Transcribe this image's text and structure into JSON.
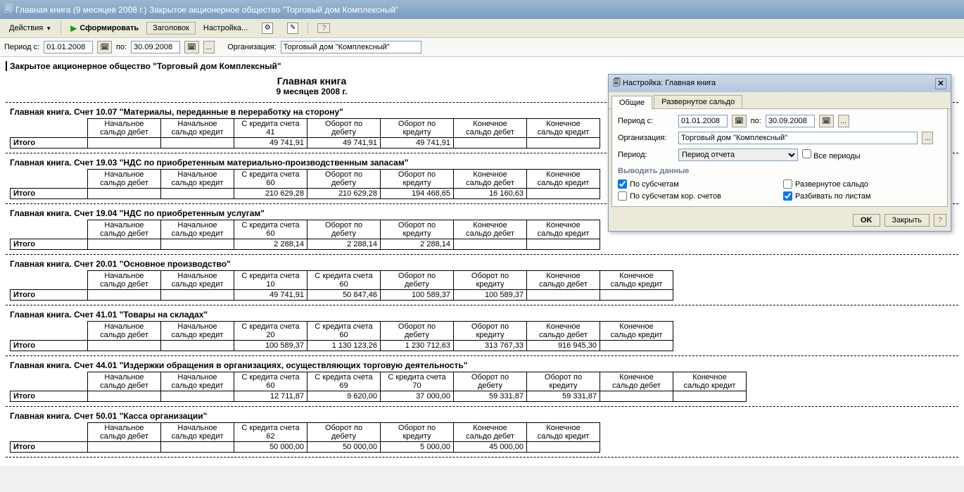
{
  "window_title": "Главная книга (9 месяцев 2008 г.) Закрытое акционерное общество \"Торговый дом Комплексный\"",
  "toolbar": {
    "actions": "Действия",
    "form": "Сформировать",
    "header": "Заголовок",
    "settings": "Настройка..."
  },
  "filter": {
    "period_from_label": "Период с:",
    "period_from": "01.01.2008",
    "period_to_label": "по:",
    "period_to": "30.09.2008",
    "org_label": "Организация:",
    "org": "Торговый дом \"Комплексный\""
  },
  "report": {
    "org_full": "Закрытое акционерное общество \"Торговый дом Комплексный\"",
    "title": "Главная книга",
    "subtitle": "9 месяцев 2008 г."
  },
  "columns": {
    "start_debit_1": "Начальное",
    "start_debit_2": "сальдо дебет",
    "start_credit_1": "Начальное",
    "start_credit_2": "сальдо кредит",
    "turn_debit_1": "Оборот по",
    "turn_debit_2": "дебету",
    "turn_credit_1": "Оборот по",
    "turn_credit_2": "кредиту",
    "end_debit_1": "Конечное",
    "end_debit_2": "сальдо дебет",
    "end_credit_1": "Конечное",
    "end_credit_2": "сальдо кредит",
    "from_credit": "С кредита счета",
    "total": "Итого"
  },
  "accounts": {
    "a1007": {
      "title": "Главная книга. Счет 10.07 \"Материалы, переданные в переработку на сторону\"",
      "credit_accts": [
        "41"
      ],
      "row": [
        "",
        "",
        "49 741,91",
        "49 741,91",
        "49 741,91",
        "",
        ""
      ]
    },
    "a1903": {
      "title": "Главная книга. Счет 19.03 \"НДС по приобретенным материально-производственным запасам\"",
      "credit_accts": [
        "60"
      ],
      "row": [
        "",
        "",
        "210 629,28",
        "210 629,28",
        "194 468,65",
        "16 160,63",
        ""
      ]
    },
    "a1904": {
      "title": "Главная книга. Счет 19.04 \"НДС по приобретенным услугам\"",
      "credit_accts": [
        "60"
      ],
      "row": [
        "",
        "",
        "2 288,14",
        "2 288,14",
        "2 288,14",
        "",
        ""
      ]
    },
    "a2001": {
      "title": "Главная книга. Счет 20.01 \"Основное производство\"",
      "credit_accts": [
        "10",
        "60"
      ],
      "row": [
        "",
        "",
        "49 741,91",
        "50 847,46",
        "100 589,37",
        "100 589,37",
        "",
        ""
      ]
    },
    "a4101": {
      "title": "Главная книга. Счет 41.01 \"Товары на складах\"",
      "credit_accts": [
        "20",
        "60"
      ],
      "row": [
        "",
        "",
        "100 589,37",
        "1 130 123,26",
        "1 230 712,63",
        "313 767,33",
        "916 945,30",
        ""
      ]
    },
    "a4401": {
      "title": "Главная книга. Счет 44.01 \"Издержки обращения в организациях, осуществляющих торговую деятельность\"",
      "credit_accts": [
        "60",
        "69",
        "70"
      ],
      "row": [
        "",
        "",
        "12 711,87",
        "9 620,00",
        "37 000,00",
        "59 331,87",
        "59 331,87",
        "",
        ""
      ]
    },
    "a5001": {
      "title": "Главная книга. Счет 50.01 \"Касса организации\"",
      "credit_accts": [
        "62"
      ],
      "row": [
        "",
        "",
        "50 000,00",
        "50 000,00",
        "5 000,00",
        "45 000,00",
        ""
      ]
    }
  },
  "settings": {
    "title": "Настройка: Главная книга",
    "tab_general": "Общие",
    "tab_expanded": "Развернутое сальдо",
    "period_from_label": "Период с:",
    "period_from": "01.01.2008",
    "period_to_label": "по:",
    "period_to": "30.09.2008",
    "org_label": "Организация:",
    "org": "Торговый дом \"Комплексный\"",
    "period_label": "Период:",
    "period_value": "Период отчета",
    "all_periods": "Все периоды",
    "output_title": "Выводить данные",
    "by_sub": "По субсчетам",
    "expanded_balance": "Развернутое сальдо",
    "by_sub_corr": "По субсчетам кор. счетов",
    "split_sheets": "Разбивать по листам",
    "ok": "OK",
    "close": "Закрыть"
  }
}
